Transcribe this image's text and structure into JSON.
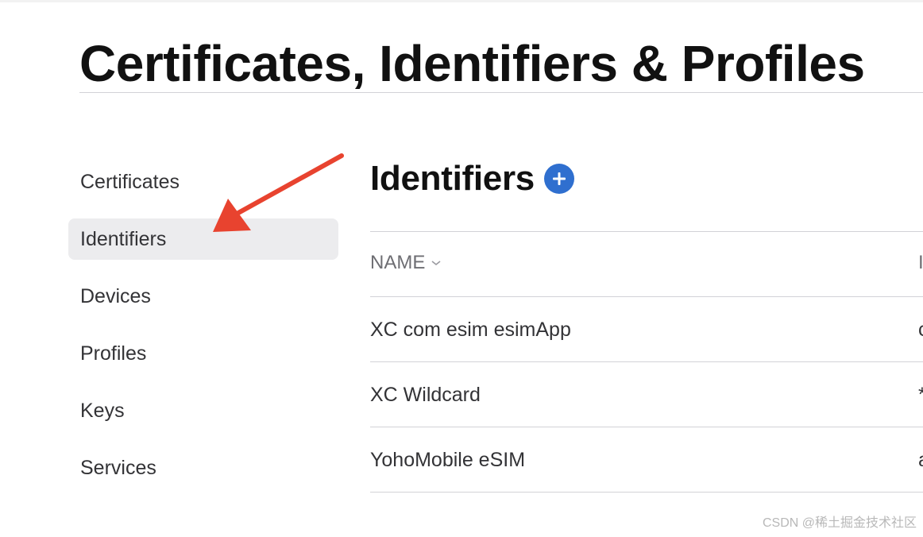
{
  "page_title": "Certificates, Identifiers & Profiles",
  "sidebar": {
    "items": [
      {
        "label": "Certificates",
        "active": false
      },
      {
        "label": "Identifiers",
        "active": true
      },
      {
        "label": "Devices",
        "active": false
      },
      {
        "label": "Profiles",
        "active": false
      },
      {
        "label": "Keys",
        "active": false
      },
      {
        "label": "Services",
        "active": false
      }
    ]
  },
  "section": {
    "title": "Identifiers",
    "add_icon": "plus-circle-icon"
  },
  "table": {
    "columns": [
      {
        "label": "NAME",
        "sort_icon": "chevron-down-icon"
      },
      {
        "label": "I"
      }
    ],
    "rows": [
      {
        "name": "XC com esim esimApp",
        "id": "c"
      },
      {
        "name": "XC Wildcard",
        "id": "*"
      },
      {
        "name": "YohoMobile eSIM",
        "id": "a"
      }
    ]
  },
  "annotation": {
    "arrow_icon": "red-arrow-icon",
    "color": "#e8432f"
  },
  "watermark": "CSDN @稀土掘金技术社区",
  "colors": {
    "accent": "#2f6fcf",
    "active_bg": "#ececee",
    "divider": "#d2d2d7",
    "muted_text": "#6e6e73"
  }
}
